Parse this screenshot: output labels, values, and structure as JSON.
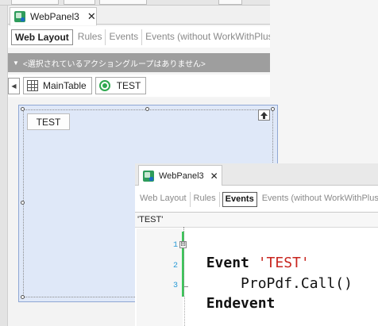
{
  "back_window": {
    "document_tab": {
      "title": "WebPanel3",
      "close": "✕"
    },
    "sub_tabs": [
      {
        "label": "Web Layout",
        "active": true
      },
      {
        "label": "Rules",
        "active": false
      },
      {
        "label": "Events",
        "active": false
      },
      {
        "label": "Events (without WorkWithPlus code)",
        "active": false
      }
    ],
    "action_bar": {
      "chevron": "▼",
      "text": "<選択されているアクショングループはありません>"
    },
    "breadcrumb": {
      "nav_arrow": "◀",
      "items": [
        {
          "label": "MainTable",
          "icon": "table-icon"
        },
        {
          "label": "TEST",
          "icon": "radio-icon"
        }
      ]
    },
    "design_surface": {
      "button_label": "TEST",
      "bg_color": "#dfe8f8",
      "border_color": "#8fa7d4"
    }
  },
  "front_window": {
    "document_tab": {
      "title": "WebPanel3",
      "close": "✕"
    },
    "sub_tabs": [
      {
        "label": "Web Layout",
        "active": false
      },
      {
        "label": "Rules",
        "active": false
      },
      {
        "label": "Events",
        "active": true
      },
      {
        "label": "Events (without WorkWithPlus code)",
        "active": false
      }
    ],
    "context": "'TEST'",
    "code_lines": [
      {
        "line": "1",
        "fold": "⊟",
        "tokens": [
          {
            "type": "keyword",
            "text": "Event"
          },
          {
            "type": "string",
            "text": " 'TEST'"
          }
        ]
      },
      {
        "line": "2",
        "fold": "",
        "tokens": [
          {
            "type": "plain",
            "text": "    ProPdf.Call()"
          }
        ]
      },
      {
        "line": "3",
        "fold": "",
        "tokens": [
          {
            "type": "keyword",
            "text": "Endevent"
          }
        ]
      }
    ],
    "colors": {
      "keyword": "#111111",
      "string": "#c8261f",
      "line_number": "#2a9ad6",
      "change_bar": "#3cc85a"
    }
  }
}
